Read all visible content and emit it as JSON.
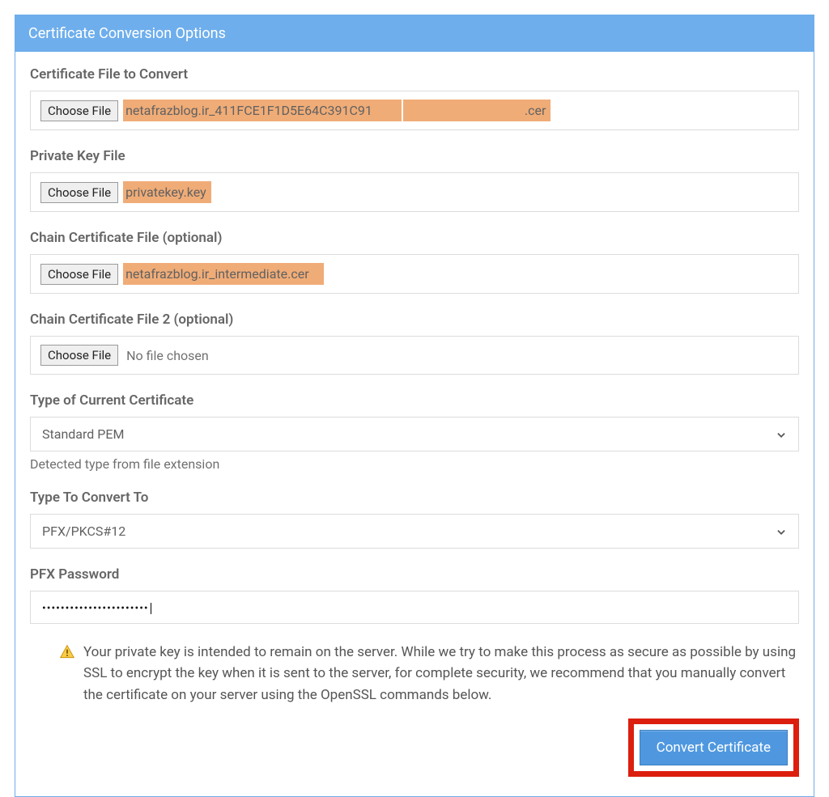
{
  "panel": {
    "title": "Certificate Conversion Options"
  },
  "fields": {
    "certFile": {
      "label": "Certificate File to Convert",
      "chooseLabel": "Choose File",
      "filename": "netafrazblog.ir_411FCE1F1D5E64C391C91",
      "ext": ".cer"
    },
    "keyFile": {
      "label": "Private Key File",
      "chooseLabel": "Choose File",
      "filename": "privatekey.key"
    },
    "chain1": {
      "label": "Chain Certificate File (optional)",
      "chooseLabel": "Choose File",
      "filename": "netafrazblog.ir_intermediate.cer"
    },
    "chain2": {
      "label": "Chain Certificate File 2 (optional)",
      "chooseLabel": "Choose File",
      "noFile": "No file chosen"
    },
    "currentType": {
      "label": "Type of Current Certificate",
      "value": "Standard PEM",
      "helper": "Detected type from file extension"
    },
    "convertTo": {
      "label": "Type To Convert To",
      "value": "PFX/PKCS#12"
    },
    "pfxPassword": {
      "label": "PFX Password",
      "masked": "•••••••••••••••••••••••"
    }
  },
  "warning": {
    "text": "Your private key is intended to remain on the server. While we try to make this process as secure as possible by using SSL to encrypt the key when it is sent to the server, for complete security, we recommend that you manually convert the certificate on your server using the OpenSSL commands below."
  },
  "actions": {
    "convert": "Convert Certificate"
  }
}
